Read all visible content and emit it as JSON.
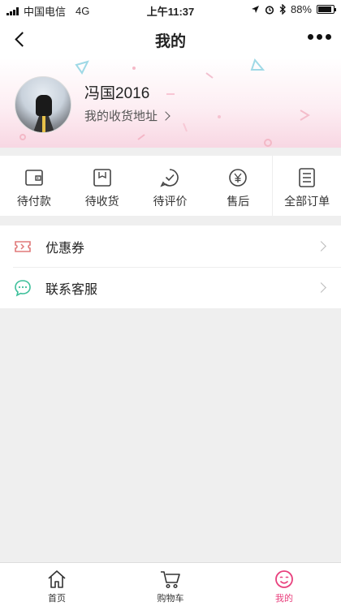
{
  "status_bar": {
    "carrier": "中国电信",
    "network": "4G",
    "time": "上午11:37",
    "battery": "88%",
    "battery_level": 0.88
  },
  "header": {
    "title": "我的"
  },
  "profile": {
    "username": "冯国2016",
    "address_link": "我的收货地址"
  },
  "orders": [
    {
      "label": "待付款",
      "icon": "wallet-icon"
    },
    {
      "label": "待收货",
      "icon": "package-icon"
    },
    {
      "label": "待评价",
      "icon": "review-check-icon"
    },
    {
      "label": "售后",
      "icon": "yuan-refund-icon"
    },
    {
      "label": "全部订单",
      "icon": "order-list-icon"
    }
  ],
  "menu": [
    {
      "label": "优惠券",
      "icon": "coupon-icon"
    },
    {
      "label": "联系客服",
      "icon": "chat-bubble-icon"
    }
  ],
  "tabbar": [
    {
      "label": "首页",
      "icon": "home-icon"
    },
    {
      "label": "购物车",
      "icon": "cart-icon"
    },
    {
      "label": "我的",
      "icon": "smiley-icon",
      "active": true
    }
  ],
  "colors": {
    "accent": "#e8407d",
    "coupon": "#e07a7a",
    "service": "#3cbf9a",
    "background": "#efefef"
  }
}
